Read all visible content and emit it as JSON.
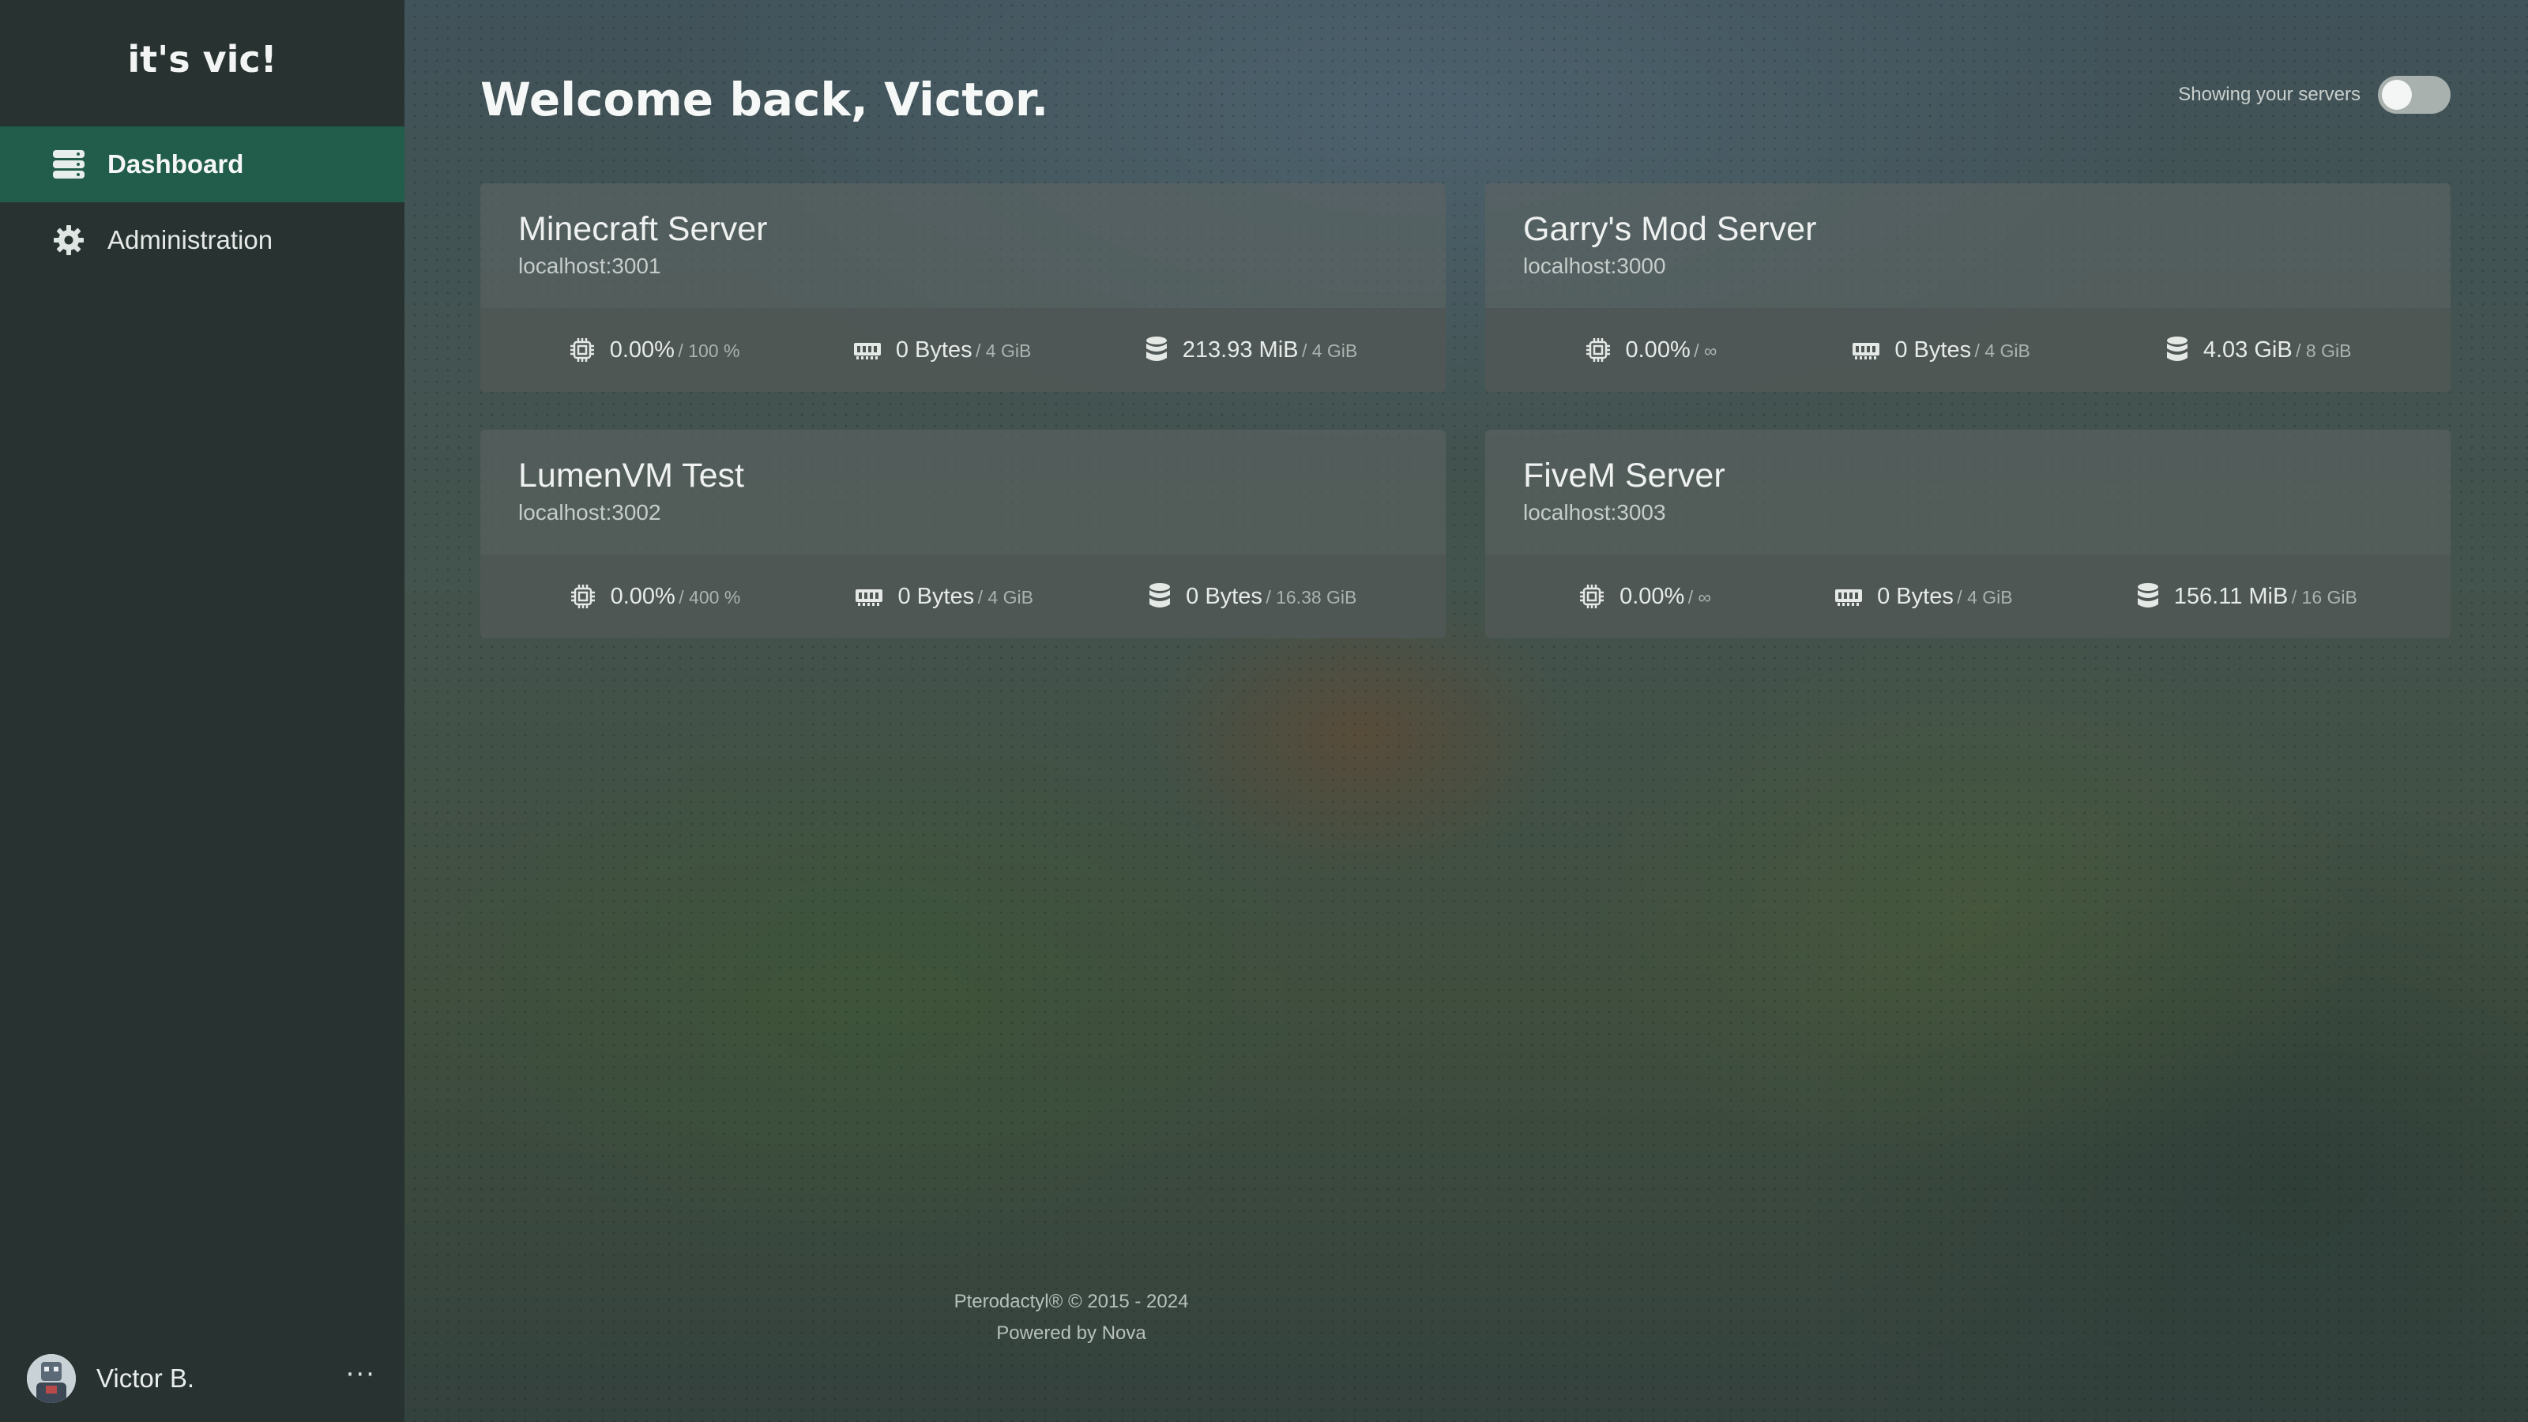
{
  "app": {
    "brand": "it's vic!"
  },
  "sidebar": {
    "items": [
      {
        "label": "Dashboard",
        "icon": "database-icon",
        "active": true
      },
      {
        "label": "Administration",
        "icon": "gear-icon",
        "active": false
      }
    ],
    "user": {
      "name": "Victor B.",
      "more_label": "···"
    }
  },
  "main": {
    "welcome": "Welcome back, Victor.",
    "toggle_label": "Showing your servers",
    "toggle_on": false
  },
  "servers": [
    {
      "name": "Minecraft Server",
      "address": "localhost:3001",
      "cpu": "0.00%",
      "cpu_limit": "/ 100 %",
      "memory": "0 Bytes",
      "memory_limit": "/ 4 GiB",
      "disk": "213.93 MiB",
      "disk_limit": "/ 4 GiB"
    },
    {
      "name": "Garry's Mod Server",
      "address": "localhost:3000",
      "cpu": "0.00%",
      "cpu_limit": "/ ∞",
      "memory": "0 Bytes",
      "memory_limit": "/ 4 GiB",
      "disk": "4.03 GiB",
      "disk_limit": "/ 8 GiB"
    },
    {
      "name": "LumenVM Test",
      "address": "localhost:3002",
      "cpu": "0.00%",
      "cpu_limit": "/ 400 %",
      "memory": "0 Bytes",
      "memory_limit": "/ 4 GiB",
      "disk": "0 Bytes",
      "disk_limit": "/ 16.38 GiB"
    },
    {
      "name": "FiveM Server",
      "address": "localhost:3003",
      "cpu": "0.00%",
      "cpu_limit": "/ ∞",
      "memory": "0 Bytes",
      "memory_limit": "/ 4 GiB",
      "disk": "156.11 MiB",
      "disk_limit": "/ 16 GiB"
    }
  ],
  "footer": {
    "copyright": "Pterodactyl® © 2015 - 2024",
    "powered": "Powered by Nova"
  },
  "colors": {
    "sidebar_bg": "#283331",
    "active_item": "#225c4a",
    "card_bg": "#5c6462"
  }
}
